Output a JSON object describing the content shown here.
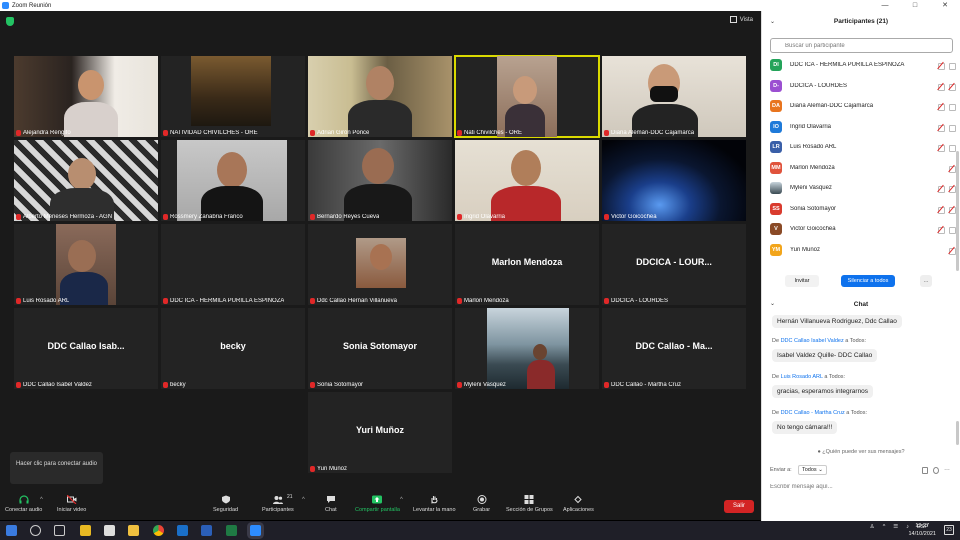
{
  "window": {
    "title": "Zoom Reunión"
  },
  "topbar": {
    "view_label": "Vista"
  },
  "tiles": [
    {
      "label": "Alejandra Rengifo"
    },
    {
      "label": "NATIVIDAD CHIVILCHES - ORE"
    },
    {
      "label": "Adrian Girón Ponce"
    },
    {
      "label": "Nati Chivilches - ORE"
    },
    {
      "label": "Diana Alemán-DDC Cajamarca"
    },
    {
      "label": "Alberto Meneses Hermoza - AGN"
    },
    {
      "label": "Rossmery Zanabria Franco"
    },
    {
      "label": "Bernardo Reyes Cueva"
    },
    {
      "label": "Ingrid Olavarria"
    },
    {
      "label": "Victor Goicochea"
    },
    {
      "label": "Luis Rosado ARL"
    },
    {
      "label": "DDC ICA - HERMILA PURILLA ESPINOZA"
    },
    {
      "label": "Ddc Callao Hernan Villanueva"
    },
    {
      "label": "Marlon Mendoza",
      "center": "Marlon Mendoza"
    },
    {
      "label": "DDCICA - LOURDES",
      "center": "DDCICA - LOUR..."
    },
    {
      "label": "DDC Callao Isabel Valdez",
      "center": "DDC Callao Isab..."
    },
    {
      "label": "becky",
      "center": "becky"
    },
    {
      "label": "Sonia Sotomayor",
      "center": "Sonia Sotomayor"
    },
    {
      "label": "Myleni Vasquez"
    },
    {
      "label": "DDC Callao - Martha Cruz",
      "center": "DDC Callao - Ma..."
    },
    {
      "label": "Yuri Muñoz",
      "center": "Yuri Muñoz"
    }
  ],
  "tooltip": {
    "audio": "Hacer clic para conectar audio"
  },
  "toolbar": {
    "audio": "Conectar audio",
    "video": "Iniciar video",
    "security": "Seguridad",
    "participants": "Participantes",
    "participants_count": "21",
    "chat": "Chat",
    "share": "Compartir pantalla",
    "raise_hand": "Levantar la mano",
    "record": "Grabar",
    "breakout": "Sección de Grupos",
    "apps": "Aplicaciones",
    "leave": "Salir"
  },
  "participants_panel": {
    "title": "Participantes (21)",
    "search_placeholder": "Buscar un participante",
    "items": [
      {
        "initials": "DI",
        "color": "#23a35a",
        "name": "DDC ICA - HERMILA PURILLA ESPINOZA"
      },
      {
        "initials": "D-",
        "color": "#9b4fd1",
        "name": "DDCICA - LOURDES"
      },
      {
        "initials": "DA",
        "color": "#e8741e",
        "name": "Diana Alemán-DDC Cajamarca"
      },
      {
        "initials": "IO",
        "color": "#1e7ad9",
        "name": "Ingrid Olavarria"
      },
      {
        "initials": "LR",
        "color": "#3a5fa8",
        "name": "Luis Rosado ARL"
      },
      {
        "initials": "MM",
        "color": "#e0533c",
        "name": "Marlon Mendoza"
      },
      {
        "initials": "",
        "color": "#6a6a6a",
        "name": "Myleni Vasquez"
      },
      {
        "initials": "SS",
        "color": "#d93b2e",
        "name": "Sonia Sotomayor"
      },
      {
        "initials": "V",
        "color": "#8a4a26",
        "name": "Victor Goicochea"
      },
      {
        "initials": "YM",
        "color": "#f2a51b",
        "name": "Yuri Muñoz"
      }
    ],
    "invite": "Invitar",
    "mute_all": "Silenciar a todos",
    "more": "..."
  },
  "chat": {
    "title": "Chat",
    "messages": [
      {
        "text": "Hernán Villanueva Rodriguez, Ddc Callao"
      },
      {
        "de": "De",
        "from": "DDC Callao Isabel Valdez",
        "to": "a Todos:",
        "text": "Isabel Valdez Quille- DDC Callao"
      },
      {
        "de": "De",
        "from": "Luis Rosado ARL",
        "to": "a Todos:",
        "text": "gracias, esperamos integrarnos"
      },
      {
        "de": "De",
        "from": "DDC Callao - Martha Cruz",
        "to": "a Todos:",
        "text": "No tengo cámara!!!"
      }
    ],
    "who_can_see": "¿Quién puede ver sus mensajes?",
    "send_to_label": "Enviar a:",
    "send_to_value": "Todos",
    "input_placeholder": "Escribir mensaje aquí..."
  },
  "taskbar": {
    "lang": "ESP",
    "time": "19:27",
    "date": "14/10/2021",
    "notifications": "23"
  }
}
